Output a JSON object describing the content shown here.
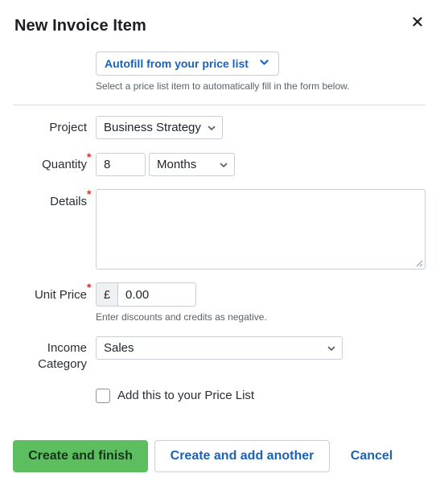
{
  "dialog": {
    "title": "New Invoice Item",
    "close_icon": "close-icon"
  },
  "autofill": {
    "label": "Autofill from your price list",
    "hint": "Select a price list item to automatically fill in the form below."
  },
  "form": {
    "project": {
      "label": "Project",
      "value": "Business Strategy",
      "required": false
    },
    "quantity": {
      "label": "Quantity",
      "value": "8",
      "unit": "Months",
      "required": true
    },
    "details": {
      "label": "Details",
      "value": "",
      "required": true
    },
    "unit_price": {
      "label": "Unit Price",
      "currency": "£",
      "value": "0.00",
      "hint": "Enter discounts and credits as negative.",
      "required": true
    },
    "income_category": {
      "label_line1": "Income",
      "label_line2": "Category",
      "value": "Sales"
    },
    "add_to_price_list": {
      "label": "Add this to your Price List",
      "checked": false
    },
    "required_marker": "*"
  },
  "actions": {
    "primary": "Create and finish",
    "secondary": "Create and add another",
    "cancel": "Cancel"
  },
  "colors": {
    "primary_button": "#5cbe5f",
    "link": "#1a62b8",
    "required": "#d0342c"
  }
}
